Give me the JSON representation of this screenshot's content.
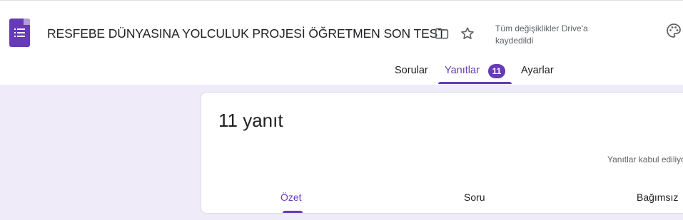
{
  "header": {
    "title": "RESFEBE DÜNYASINA YOLCULUK PROJESİ ÖĞRETMEN SON TEST",
    "save_status": "Tüm değişiklikler Drive'a kaydedildi",
    "icons": [
      "forms-icon",
      "folder-icon",
      "star-icon",
      "palette-icon"
    ]
  },
  "tabs": {
    "questions": "Sorular",
    "responses": "Yanıtlar",
    "responses_count": "11",
    "settings": "Ayarlar",
    "active": "responses"
  },
  "responses_card": {
    "count_label": "11 yanıt",
    "accepting_label": "Yanıtlar kabul ediliyor",
    "subtabs": {
      "summary": "Özet",
      "question": "Soru",
      "individual": "Bağımsız",
      "active": "summary"
    }
  },
  "colors": {
    "accent": "#673ab7",
    "background": "#f0ebf8"
  }
}
